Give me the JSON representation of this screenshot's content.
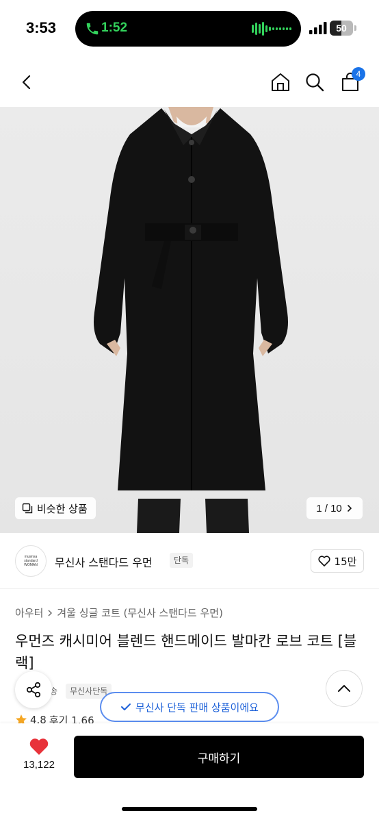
{
  "status_bar": {
    "time": "3:53",
    "call_duration": "1:52",
    "battery_level": "50",
    "battery_fraction": 0.5
  },
  "header": {
    "cart_badge": "4",
    "icons": [
      "back-icon",
      "home-icon",
      "search-icon",
      "cart-icon"
    ]
  },
  "gallery": {
    "similar_label": "비슷한 상품",
    "page_counter": "1 / 10"
  },
  "brand": {
    "logo_line1": "musinsa",
    "logo_line2": "standard",
    "logo_line3": "WOMAN",
    "name": "무신사 스탠다드 우먼",
    "tag": "단독",
    "like_count": "15만"
  },
  "product": {
    "category_main": "아우터",
    "category_sub": "겨울 싱글 코트 (무신사 스탠다드 우먼)",
    "title": "우먼즈 캐시미어 블렌드 핸드메이드 발마칸 로브 코트 [블랙]",
    "tag_delivery": "배송",
    "tag_exclusive": "무신사단독",
    "rating": "4.8",
    "review_label": "후기 1,66"
  },
  "toast": {
    "label": "무신사 단독 판매 상품이에요"
  },
  "bottom_bar": {
    "wish_count": "13,122",
    "buy_label": "구매하기"
  },
  "colors": {
    "accent_blue": "#1a73e8",
    "toast_border": "#5b8def",
    "heart_red": "#e8323a",
    "call_green": "#33d35c"
  }
}
